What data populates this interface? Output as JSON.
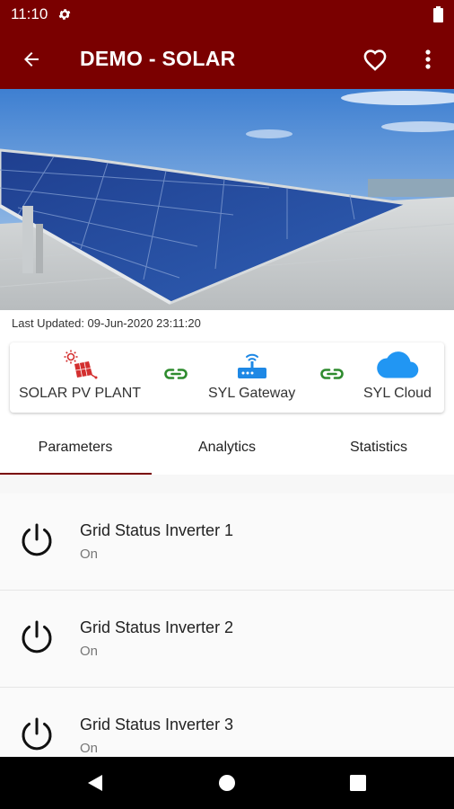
{
  "status_bar": {
    "time": "11:10"
  },
  "app_bar": {
    "title": "DEMO - SOLAR"
  },
  "last_updated": "Last Updated: 09-Jun-2020 23:11:20",
  "topology": {
    "nodes": [
      {
        "label": "SOLAR PV PLANT",
        "icon": "solar-panel-icon"
      },
      {
        "label": "SYL Gateway",
        "icon": "router-icon"
      },
      {
        "label": "SYL Cloud",
        "icon": "cloud-icon"
      }
    ],
    "link_icon": "link-icon"
  },
  "tabs": [
    {
      "label": "Parameters",
      "active": true
    },
    {
      "label": "Analytics",
      "active": false
    },
    {
      "label": "Statistics",
      "active": false
    }
  ],
  "parameters": [
    {
      "title": "Grid Status Inverter 1",
      "value": "On",
      "icon": "power-icon"
    },
    {
      "title": "Grid Status Inverter 2",
      "value": "On",
      "icon": "power-icon"
    },
    {
      "title": "Grid Status Inverter 3",
      "value": "On",
      "icon": "power-icon"
    }
  ],
  "colors": {
    "brand": "#7a0000",
    "link": "#2e8b2e",
    "gateway": "#1e88e5",
    "solar": "#d32f2f"
  }
}
